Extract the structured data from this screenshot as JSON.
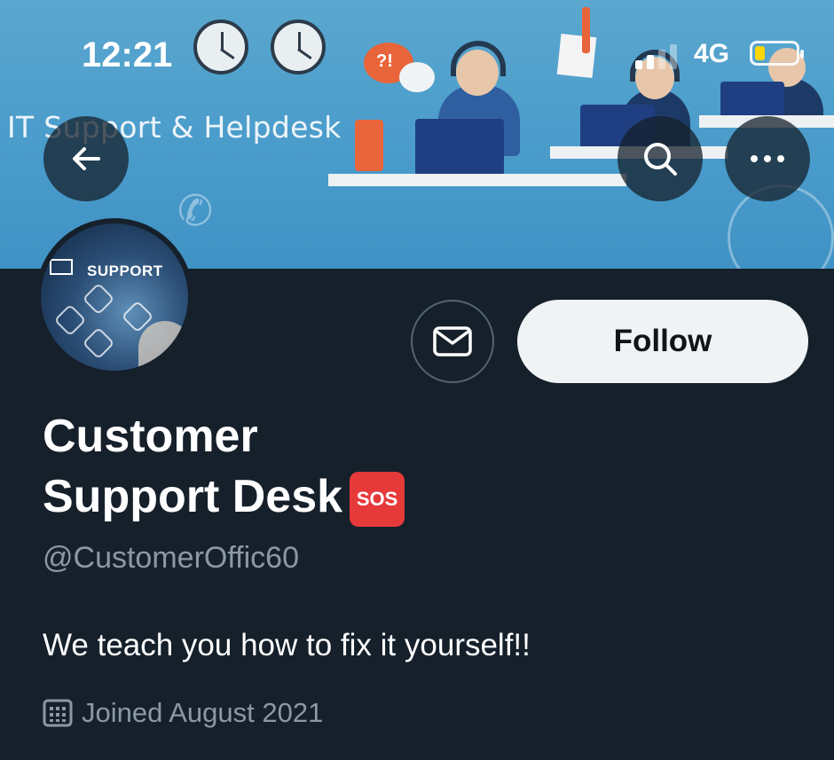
{
  "status_bar": {
    "time": "12:21",
    "network": "4G"
  },
  "banner": {
    "title": "IT Support & Helpdesk",
    "bubble_text": "?!"
  },
  "avatar": {
    "text": "SUPPORT"
  },
  "actions": {
    "follow_label": "Follow"
  },
  "profile": {
    "name_line1": "Customer",
    "name_line2": "Support Desk",
    "name_emoji": "SOS",
    "handle": "@CustomerOffic60",
    "bio": "We teach you how to fix it yourself!!",
    "joined": "Joined August 2021"
  },
  "icons": {
    "back": "back-arrow-icon",
    "search": "search-icon",
    "more": "more-icon",
    "message": "envelope-icon",
    "calendar": "calendar-icon"
  }
}
